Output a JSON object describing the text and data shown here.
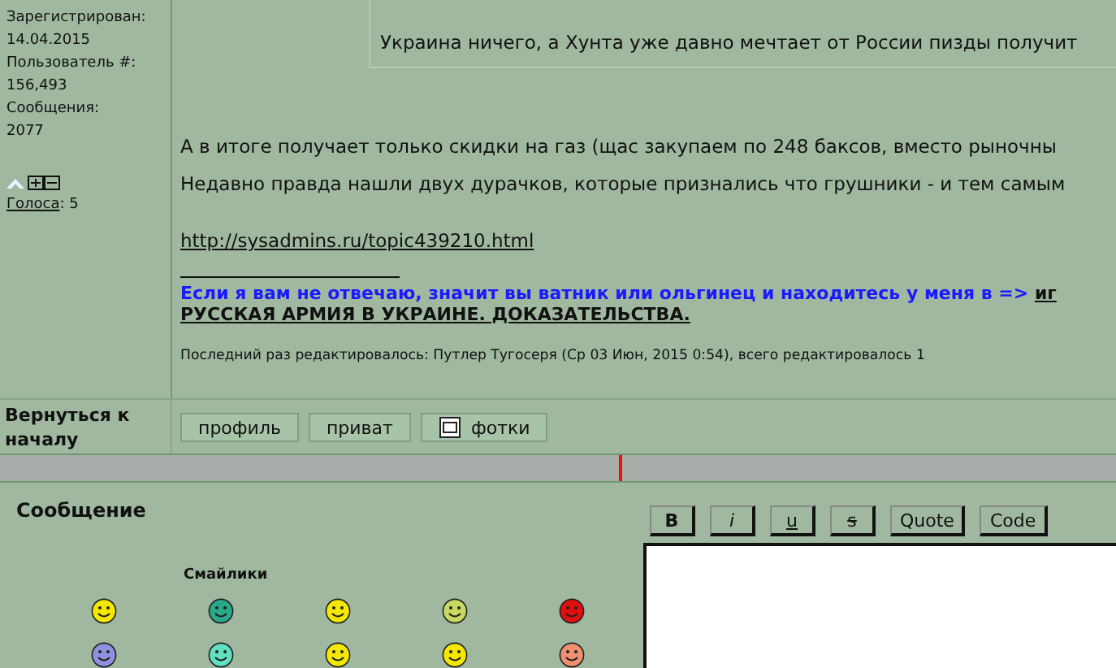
{
  "profile": {
    "fields": [
      {
        "label": "Зарегистрирован:",
        "value": "14.04.2015"
      },
      {
        "label": "Пользователь #:",
        "value": "156,493"
      },
      {
        "label": "Сообщения:",
        "value": "2077"
      }
    ],
    "votes_link": "Голоса",
    "votes_count": ": 5"
  },
  "post": {
    "quote": "Украина ничего, а Хунта уже давно мечтает от России пизды получит",
    "paragraphs": [
      "А в итоге получает только скидки на газ (щас закупаем по 248 баксов, вместо рыночны",
      "Недавно правда нашли двух дурачков, которые признались что грушники - и тем самым"
    ],
    "link": "http://sysadmins.ru/topic439210.html",
    "signature": "Если я вам не отвечаю, значит вы ватник или ольгинец и находитесь у меня в =>",
    "signature_link": "иг",
    "signature_link2": "РУССКАЯ АРМИЯ В УКРАИНЕ. ДОКАЗАТЕЛЬСТВА.",
    "edited": "Последний раз редактировалось: Путлер Тугосеря (Ср 03 Июн, 2015 0:54), всего редактировалось 1"
  },
  "back_to_top": "Вернуться к началу",
  "actions": [
    {
      "label": "профиль",
      "kind": "plain"
    },
    {
      "label": "приват",
      "kind": "plain"
    },
    {
      "label": "фотки",
      "kind": "photo"
    }
  ],
  "reply": {
    "title": "Сообщение",
    "smilies_title": "Смайлики",
    "format_buttons": [
      {
        "label": "B",
        "kind": "bold"
      },
      {
        "label": "i",
        "kind": "italic"
      },
      {
        "label": "u",
        "kind": "underline"
      },
      {
        "label": "s",
        "kind": "strike"
      },
      {
        "label": "Quote",
        "kind": "plain"
      },
      {
        "label": "Code",
        "kind": "plain"
      }
    ],
    "smilies": [
      {
        "color": "#f4e800"
      },
      {
        "color": "#2aa88a"
      },
      {
        "color": "#f4e800"
      },
      {
        "color": "#c8d860"
      },
      {
        "color": "#e01010"
      },
      {
        "color": "#9090e0"
      },
      {
        "color": "#60e0c0"
      },
      {
        "color": "#f4e800"
      },
      {
        "color": "#f4e800"
      },
      {
        "color": "#f09070"
      }
    ]
  }
}
